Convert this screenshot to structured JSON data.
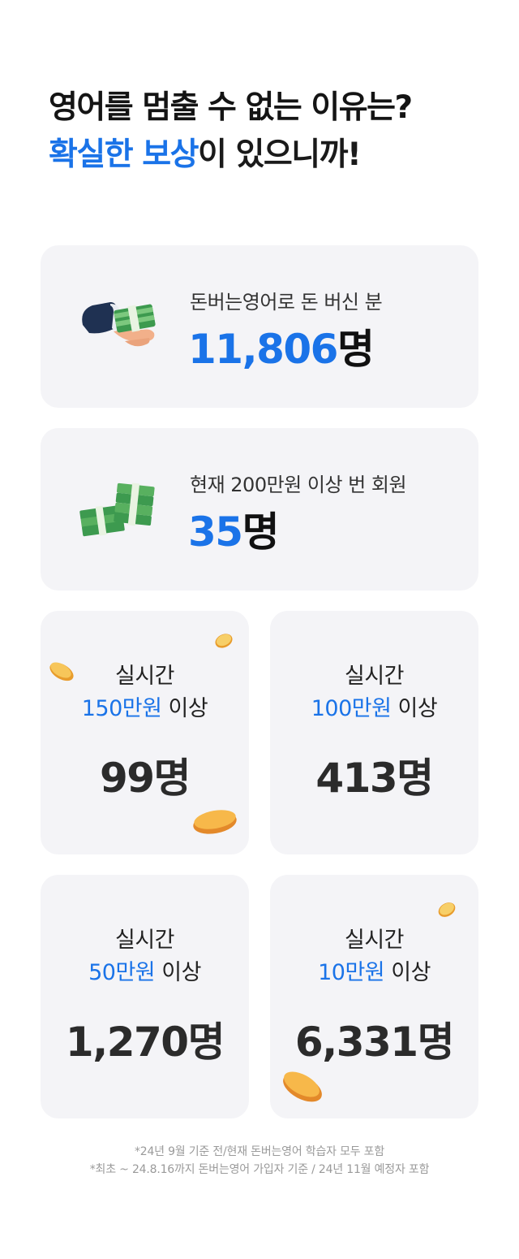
{
  "headline": {
    "line1": "영어를 멈출 수 없는 이유는?",
    "line2_accent": "확실한 보상",
    "line2_rest": "이 있으니까!"
  },
  "cards": [
    {
      "label": "돈버는영어로 돈 버신 분",
      "number": "11,806",
      "unit": "명",
      "icon": "hand-giving-money-icon"
    },
    {
      "label": "현재 200만원 이상 번 회원",
      "number": "35",
      "unit": "명",
      "icon": "money-stacks-icon"
    }
  ],
  "stats": [
    {
      "line1": "실시간",
      "amount": "150만원",
      "suffix": " 이상",
      "count": "99명"
    },
    {
      "line1": "실시간",
      "amount": "100만원",
      "suffix": " 이상",
      "count": "413명"
    },
    {
      "line1": "실시간",
      "amount": "50만원",
      "suffix": " 이상",
      "count": "1,270명"
    },
    {
      "line1": "실시간",
      "amount": "10만원",
      "suffix": " 이상",
      "count": "6,331명"
    }
  ],
  "footnotes": [
    "*24년 9월 기준 전/현재 돈버는영어 학습자 모두 포함",
    "*최초 ~ 24.8.16까지 돈버는영어 가입자 기준 / 24년 11월 예정자 포함"
  ],
  "colors": {
    "accent": "#1a73e8",
    "card_bg": "#f4f4f7",
    "coin": "#f0a93a"
  }
}
